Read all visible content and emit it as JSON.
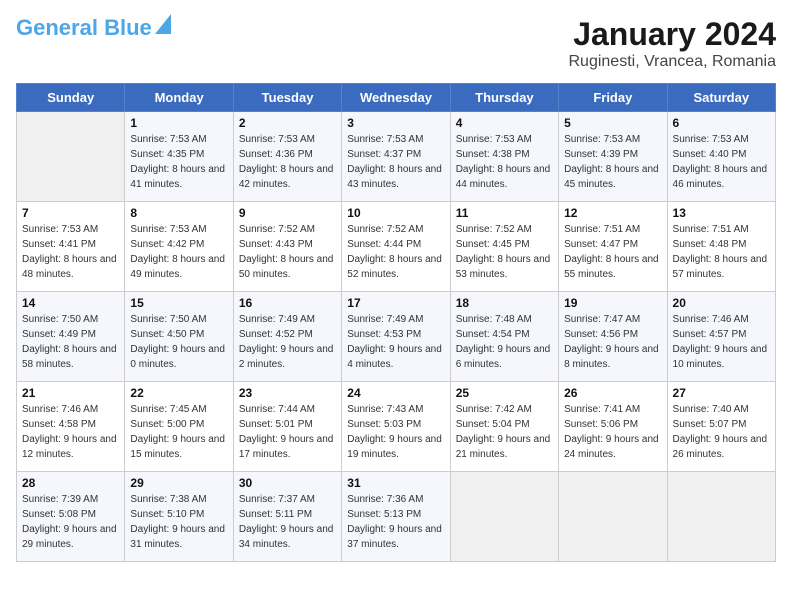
{
  "header": {
    "logo_general": "General",
    "logo_blue": "Blue",
    "month_year": "January 2024",
    "location": "Ruginesti, Vrancea, Romania"
  },
  "days_of_week": [
    "Sunday",
    "Monday",
    "Tuesday",
    "Wednesday",
    "Thursday",
    "Friday",
    "Saturday"
  ],
  "weeks": [
    [
      {
        "day": "",
        "sunrise": "",
        "sunset": "",
        "daylight": ""
      },
      {
        "day": "1",
        "sunrise": "Sunrise: 7:53 AM",
        "sunset": "Sunset: 4:35 PM",
        "daylight": "Daylight: 8 hours and 41 minutes."
      },
      {
        "day": "2",
        "sunrise": "Sunrise: 7:53 AM",
        "sunset": "Sunset: 4:36 PM",
        "daylight": "Daylight: 8 hours and 42 minutes."
      },
      {
        "day": "3",
        "sunrise": "Sunrise: 7:53 AM",
        "sunset": "Sunset: 4:37 PM",
        "daylight": "Daylight: 8 hours and 43 minutes."
      },
      {
        "day": "4",
        "sunrise": "Sunrise: 7:53 AM",
        "sunset": "Sunset: 4:38 PM",
        "daylight": "Daylight: 8 hours and 44 minutes."
      },
      {
        "day": "5",
        "sunrise": "Sunrise: 7:53 AM",
        "sunset": "Sunset: 4:39 PM",
        "daylight": "Daylight: 8 hours and 45 minutes."
      },
      {
        "day": "6",
        "sunrise": "Sunrise: 7:53 AM",
        "sunset": "Sunset: 4:40 PM",
        "daylight": "Daylight: 8 hours and 46 minutes."
      }
    ],
    [
      {
        "day": "7",
        "sunrise": "Sunrise: 7:53 AM",
        "sunset": "Sunset: 4:41 PM",
        "daylight": "Daylight: 8 hours and 48 minutes."
      },
      {
        "day": "8",
        "sunrise": "Sunrise: 7:53 AM",
        "sunset": "Sunset: 4:42 PM",
        "daylight": "Daylight: 8 hours and 49 minutes."
      },
      {
        "day": "9",
        "sunrise": "Sunrise: 7:52 AM",
        "sunset": "Sunset: 4:43 PM",
        "daylight": "Daylight: 8 hours and 50 minutes."
      },
      {
        "day": "10",
        "sunrise": "Sunrise: 7:52 AM",
        "sunset": "Sunset: 4:44 PM",
        "daylight": "Daylight: 8 hours and 52 minutes."
      },
      {
        "day": "11",
        "sunrise": "Sunrise: 7:52 AM",
        "sunset": "Sunset: 4:45 PM",
        "daylight": "Daylight: 8 hours and 53 minutes."
      },
      {
        "day": "12",
        "sunrise": "Sunrise: 7:51 AM",
        "sunset": "Sunset: 4:47 PM",
        "daylight": "Daylight: 8 hours and 55 minutes."
      },
      {
        "day": "13",
        "sunrise": "Sunrise: 7:51 AM",
        "sunset": "Sunset: 4:48 PM",
        "daylight": "Daylight: 8 hours and 57 minutes."
      }
    ],
    [
      {
        "day": "14",
        "sunrise": "Sunrise: 7:50 AM",
        "sunset": "Sunset: 4:49 PM",
        "daylight": "Daylight: 8 hours and 58 minutes."
      },
      {
        "day": "15",
        "sunrise": "Sunrise: 7:50 AM",
        "sunset": "Sunset: 4:50 PM",
        "daylight": "Daylight: 9 hours and 0 minutes."
      },
      {
        "day": "16",
        "sunrise": "Sunrise: 7:49 AM",
        "sunset": "Sunset: 4:52 PM",
        "daylight": "Daylight: 9 hours and 2 minutes."
      },
      {
        "day": "17",
        "sunrise": "Sunrise: 7:49 AM",
        "sunset": "Sunset: 4:53 PM",
        "daylight": "Daylight: 9 hours and 4 minutes."
      },
      {
        "day": "18",
        "sunrise": "Sunrise: 7:48 AM",
        "sunset": "Sunset: 4:54 PM",
        "daylight": "Daylight: 9 hours and 6 minutes."
      },
      {
        "day": "19",
        "sunrise": "Sunrise: 7:47 AM",
        "sunset": "Sunset: 4:56 PM",
        "daylight": "Daylight: 9 hours and 8 minutes."
      },
      {
        "day": "20",
        "sunrise": "Sunrise: 7:46 AM",
        "sunset": "Sunset: 4:57 PM",
        "daylight": "Daylight: 9 hours and 10 minutes."
      }
    ],
    [
      {
        "day": "21",
        "sunrise": "Sunrise: 7:46 AM",
        "sunset": "Sunset: 4:58 PM",
        "daylight": "Daylight: 9 hours and 12 minutes."
      },
      {
        "day": "22",
        "sunrise": "Sunrise: 7:45 AM",
        "sunset": "Sunset: 5:00 PM",
        "daylight": "Daylight: 9 hours and 15 minutes."
      },
      {
        "day": "23",
        "sunrise": "Sunrise: 7:44 AM",
        "sunset": "Sunset: 5:01 PM",
        "daylight": "Daylight: 9 hours and 17 minutes."
      },
      {
        "day": "24",
        "sunrise": "Sunrise: 7:43 AM",
        "sunset": "Sunset: 5:03 PM",
        "daylight": "Daylight: 9 hours and 19 minutes."
      },
      {
        "day": "25",
        "sunrise": "Sunrise: 7:42 AM",
        "sunset": "Sunset: 5:04 PM",
        "daylight": "Daylight: 9 hours and 21 minutes."
      },
      {
        "day": "26",
        "sunrise": "Sunrise: 7:41 AM",
        "sunset": "Sunset: 5:06 PM",
        "daylight": "Daylight: 9 hours and 24 minutes."
      },
      {
        "day": "27",
        "sunrise": "Sunrise: 7:40 AM",
        "sunset": "Sunset: 5:07 PM",
        "daylight": "Daylight: 9 hours and 26 minutes."
      }
    ],
    [
      {
        "day": "28",
        "sunrise": "Sunrise: 7:39 AM",
        "sunset": "Sunset: 5:08 PM",
        "daylight": "Daylight: 9 hours and 29 minutes."
      },
      {
        "day": "29",
        "sunrise": "Sunrise: 7:38 AM",
        "sunset": "Sunset: 5:10 PM",
        "daylight": "Daylight: 9 hours and 31 minutes."
      },
      {
        "day": "30",
        "sunrise": "Sunrise: 7:37 AM",
        "sunset": "Sunset: 5:11 PM",
        "daylight": "Daylight: 9 hours and 34 minutes."
      },
      {
        "day": "31",
        "sunrise": "Sunrise: 7:36 AM",
        "sunset": "Sunset: 5:13 PM",
        "daylight": "Daylight: 9 hours and 37 minutes."
      },
      {
        "day": "",
        "sunrise": "",
        "sunset": "",
        "daylight": ""
      },
      {
        "day": "",
        "sunrise": "",
        "sunset": "",
        "daylight": ""
      },
      {
        "day": "",
        "sunrise": "",
        "sunset": "",
        "daylight": ""
      }
    ]
  ]
}
